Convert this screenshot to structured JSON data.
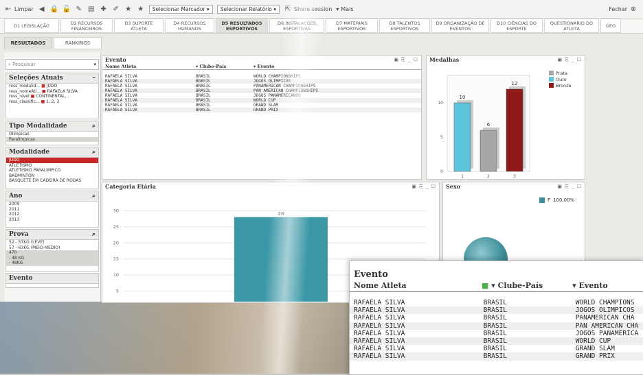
{
  "toolbar": {
    "clear_label": "Limpar",
    "bookmark_select": "Selecionar Marcador",
    "report_select": "Selecionar Relatório",
    "share_label": "Share session",
    "more_label": "Mais",
    "close_label": "Fechar"
  },
  "tabs": [
    {
      "label": "D1 LEGISLAÇÃO"
    },
    {
      "label": "D2 RECURSOS FINANCEIROS"
    },
    {
      "label": "D3 SUPORTE ATLETA"
    },
    {
      "label": "D4 RECURSOS HUMANOS"
    },
    {
      "label": "D5 RESULTADOS ESPORTIVOS"
    },
    {
      "label": "D6 INSTALAÇÕES ESPORTIVAS"
    },
    {
      "label": "D7 MATERIAIS ESPORTIVOS"
    },
    {
      "label": "D8 TALENTOS ESPORTIVOS"
    },
    {
      "label": "D9 ORGANIZAÇÃO DE EVENTOS"
    },
    {
      "label": "D10 CIÊNCIAS DO ESPORTE"
    },
    {
      "label": "QUESTIONÁRIO DO ATLETA"
    },
    {
      "label": "GEO"
    }
  ],
  "subtabs": [
    "RESULTADOS",
    "RANKINGS"
  ],
  "left": {
    "search_placeholder": "Pesquisar",
    "current_selections_title": "Seleções Atuais",
    "current_selections": [
      {
        "field": "ress_modalid...",
        "value": "JUDÔ"
      },
      {
        "field": "ress_nomeAtl...",
        "value": "RAFAELA SILVA"
      },
      {
        "field": "ress_nivel",
        "value": "CONTINENTAL,..."
      },
      {
        "field": "ress_classific...",
        "value": "1, 2, 3"
      }
    ],
    "tipo_title": "Tipo Modalidade",
    "tipo_items": [
      "Olímpicas",
      "Paralímpicas"
    ],
    "modalidade_title": "Modalidade",
    "modalidade_items": [
      "JUDÔ",
      "ATLETISMO",
      "ATLETISMO PARALÍMPICO",
      "BADMINTON",
      "BASQUETE EM CADEIRA DE RODAS"
    ],
    "ano_title": "Ano",
    "ano_items": [
      "2009",
      "2011",
      "2012",
      "2013"
    ],
    "prova_title": "Prova",
    "prova_items": [
      "52 - 57KG (LEVE)",
      "57 - 63KG (MEIO-MÉDIO)",
      "470",
      "- 48 KG",
      "- 48KG"
    ],
    "evento_title": "Evento"
  },
  "evento_table": {
    "title": "Evento",
    "col_athlete": "Nome Atleta",
    "col_club": "Clube-País",
    "col_event": "Evento",
    "rows": [
      {
        "athlete": "RAFAELA SILVA",
        "club": "BRASIL",
        "event": "WORLD CHAMPIONSHIPS"
      },
      {
        "athlete": "RAFAELA SILVA",
        "club": "BRASIL",
        "event": "JOGOS OLIMPICOS"
      },
      {
        "athlete": "RAFAELA SILVA",
        "club": "BRASIL",
        "event": "PANAMERICAN CHAMPIONSHIPS"
      },
      {
        "athlete": "RAFAELA SILVA",
        "club": "BRASIL",
        "event": "PAN AMERICAN CHAMPIONSHIPS"
      },
      {
        "athlete": "RAFAELA SILVA",
        "club": "BRASIL",
        "event": "JOGOS PANAMERICANOS"
      },
      {
        "athlete": "RAFAELA SILVA",
        "club": "BRASIL",
        "event": "WORLD CUP"
      },
      {
        "athlete": "RAFAELA SILVA",
        "club": "BRASIL",
        "event": "GRAND SLAM"
      },
      {
        "athlete": "RAFAELA SILVA",
        "club": "BRASIL",
        "event": "GRAND PRIX"
      }
    ]
  },
  "zoom_table": {
    "title": "Evento",
    "col_athlete": "Nome Atleta",
    "col_club": "Clube-País",
    "col_event": "Evento",
    "rows": [
      {
        "athlete": "RAFAELA SILVA",
        "club": "BRASIL",
        "event": "WORLD CHAMPIONS"
      },
      {
        "athlete": "RAFAELA SILVA",
        "club": "BRASIL",
        "event": "JOGOS OLIMPICOS"
      },
      {
        "athlete": "RAFAELA SILVA",
        "club": "BRASIL",
        "event": "PANAMERICAN CHA"
      },
      {
        "athlete": "RAFAELA SILVA",
        "club": "BRASIL",
        "event": "PAN AMERICAN CHA"
      },
      {
        "athlete": "RAFAELA SILVA",
        "club": "BRASIL",
        "event": "JOGOS PANAMERICA"
      },
      {
        "athlete": "RAFAELA SILVA",
        "club": "BRASIL",
        "event": "WORLD CUP"
      },
      {
        "athlete": "RAFAELA SILVA",
        "club": "BRASIL",
        "event": "GRAND SLAM"
      },
      {
        "athlete": "RAFAELA SILVA",
        "club": "BRASIL",
        "event": "GRAND PRIX"
      }
    ]
  },
  "medalhas": {
    "title": "Medalhas",
    "legend": [
      {
        "name": "Prata",
        "color": "#a7a7a7"
      },
      {
        "name": "Ouro",
        "color": "#5ec4dc"
      },
      {
        "name": "Bronze",
        "color": "#8e1a1a"
      }
    ]
  },
  "categoria": {
    "title": "Categoria Etária"
  },
  "sexo": {
    "title": "Sexo",
    "legend_label": "F",
    "legend_value": "100,00%",
    "color": "#3f8f99"
  },
  "chart_data": [
    {
      "type": "bar",
      "title": "Medalhas",
      "categories": [
        "1",
        "2",
        "3"
      ],
      "series": [
        {
          "name": "Ouro",
          "values": [
            10,
            0,
            0
          ],
          "color": "#5ec4dc"
        },
        {
          "name": "Prata",
          "values": [
            0,
            6,
            0
          ],
          "color": "#a7a7a7"
        },
        {
          "name": "Bronze",
          "values": [
            0,
            0,
            12
          ],
          "color": "#8e1a1a"
        }
      ],
      "yticks": [
        0,
        5,
        10
      ],
      "ylim": [
        0,
        14
      ],
      "legend": "right"
    },
    {
      "type": "bar",
      "title": "Categoria Etária",
      "categories": [
        ""
      ],
      "values": [
        28
      ],
      "yticks": [
        5,
        10,
        15,
        20,
        25,
        30
      ],
      "ylim": [
        0,
        32
      ],
      "color": "#3a97a6"
    }
  ]
}
